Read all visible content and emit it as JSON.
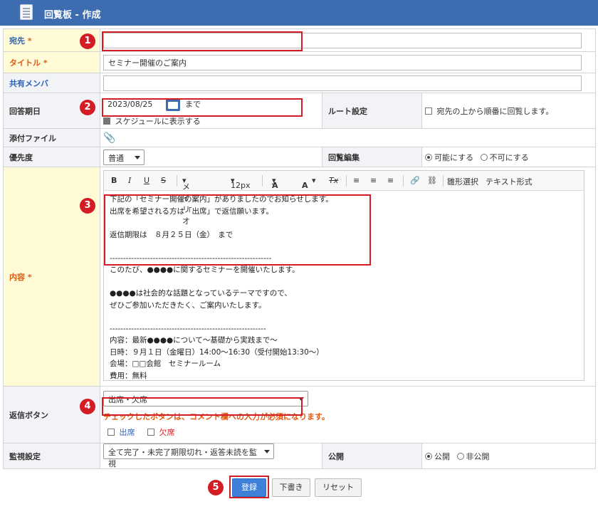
{
  "window": {
    "title": "回覧板 - 作成"
  },
  "labels": {
    "to": "宛先",
    "title": "タイトル",
    "members": "共有メンバ",
    "due": "回答期日",
    "attach": "添付ファイル",
    "priority": "優先度",
    "content": "内容",
    "reply_button": "返信ボタン",
    "monitor": "監視設定",
    "route": "ルート設定",
    "edit": "回覧編集",
    "public": "公開",
    "required_mark": "*"
  },
  "fields": {
    "to_value": "",
    "title_value": "セミナー開催のご案内",
    "due_date": "2023/08/25",
    "due_suffix": "まで",
    "show_schedule": "スケジュールに表示する",
    "route_option": "宛先の上から順番に回覧します。",
    "priority_value": "普通",
    "edit_enable": "可能にする",
    "edit_disable": "不可にする",
    "reply_select": "出席・欠席",
    "reply_warning": "チェックしたボタンは、コメント欄への入力が必須になります。",
    "reply_opt1": "出席",
    "reply_opt2": "欠席",
    "monitor_value": "全て完了・未完了期限切れ・返答未読を監視",
    "public_on": "公開",
    "public_off": "非公開"
  },
  "editor": {
    "bold": "B",
    "italic": "I",
    "underline": "U",
    "strike": "S",
    "font": "メイリオ",
    "size": "12px",
    "font_color": "A",
    "bg_color": "A",
    "clear_format": "Tx",
    "template": "雛形選択",
    "text_mode": "テキスト形式",
    "content": "下記の「セミナー開催の案内」がありましたのでお知らせします。\n出席を希望される方は「出席」で返信願います。\n\n返信期限は　８月２５日（金）　まで\n\n------------------------------------------------------------\nこのたび、●●●●に関するセミナーを開催いたします。\n\n●●●●は社会的な話題となっているテーマですので、\nぜひご参加いただきたく、ご案内いたします。\n\n----------------------------------------------------------\n内容：最新●●●●について～基礎から実践まで～\n日時：９月１日（金曜日）14:00～16:30（受付開始13:30～）\n会場：□□会館　セミナールーム\n費用：無料\n詳細：http://□□□.com/seminar"
  },
  "buttons": {
    "register": "登録",
    "draft": "下書き",
    "reset": "リセット"
  },
  "badges": [
    "1",
    "2",
    "3",
    "4",
    "5"
  ],
  "colors": {
    "header": "#3d6cb0",
    "annotation": "#d31c24",
    "primary": "#3f80d8",
    "warning": "#e05a12"
  }
}
